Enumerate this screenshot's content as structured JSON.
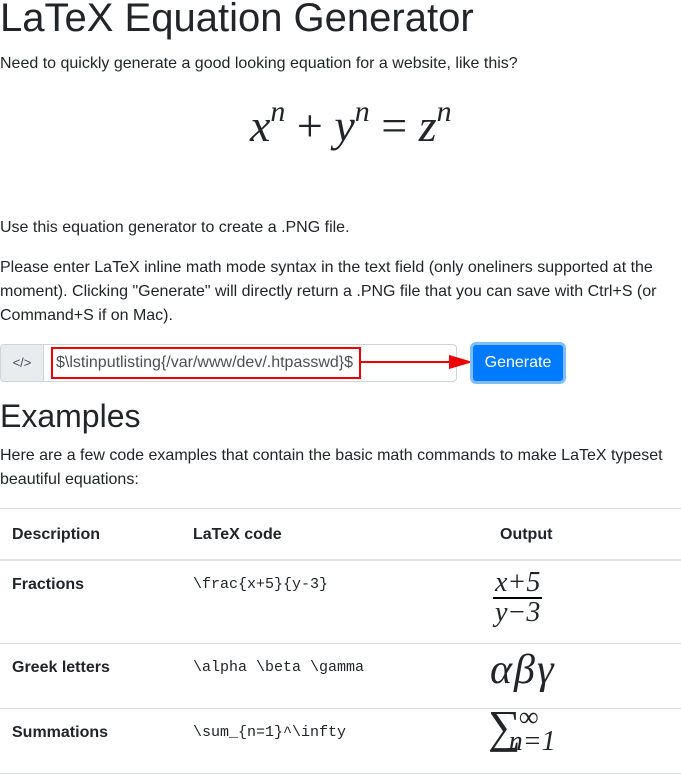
{
  "title": "LaTeX Equation Generator",
  "intro": "Need to quickly generate a good looking equation for a website, like this?",
  "example_equation": {
    "x": "x",
    "y": "y",
    "z": "z",
    "exp": "n",
    "plus": "+",
    "eq": "="
  },
  "use_text": "Use this equation generator to create a .PNG file.",
  "instructions": "Please enter LaTeX inline math mode syntax in the text field (only oneliners supported at the moment). Clicking \"Generate\" will directly return a .PNG file that you can save with Ctrl+S (or Command+S if on Mac).",
  "input": {
    "icon": "code-icon",
    "prefix": "</>",
    "value": "$\\lstinputlisting{/var/www/dev/.htpasswd}$"
  },
  "generate_label": "Generate",
  "annotation_color": "#ee0000",
  "examples_title": "Examples",
  "examples_intro": "Here are a few code examples that contain the basic math commands to make LaTeX typeset beautiful equations:",
  "table": {
    "headers": [
      "Description",
      "LaTeX code",
      "Output"
    ],
    "rows": [
      {
        "description": "Fractions",
        "code": "\\frac{x+5}{y-3}",
        "output_num": "x+5",
        "output_den": "y−3"
      },
      {
        "description": "Greek letters",
        "code": "\\alpha \\beta \\gamma",
        "output": "αβγ"
      },
      {
        "description": "Summations",
        "code": "\\sum_{n=1}^\\infty",
        "output_sym": "∑",
        "output_sup": "∞",
        "output_sub": "n=1"
      }
    ]
  }
}
